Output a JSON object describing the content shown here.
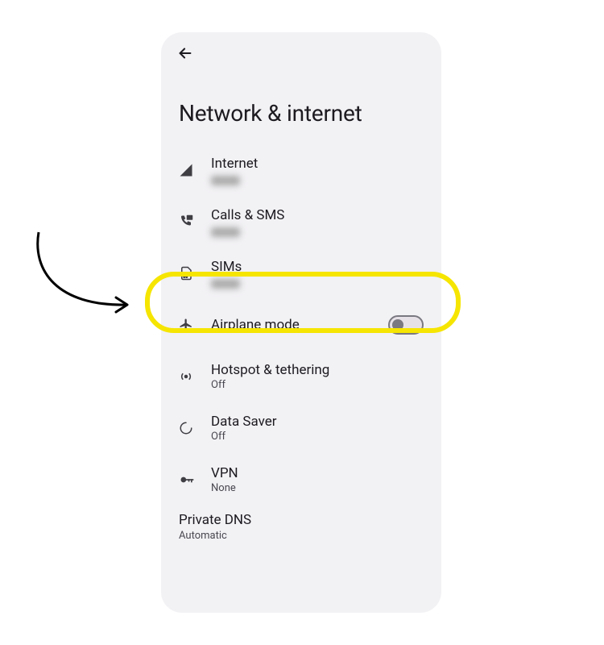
{
  "header": {
    "back_icon": "←",
    "title": "Network & internet"
  },
  "items": {
    "internet": {
      "label": "Internet",
      "subtitle": ""
    },
    "calls_sms": {
      "label": "Calls & SMS",
      "subtitle": ""
    },
    "sims": {
      "label": "SIMs",
      "subtitle": ""
    },
    "airplane": {
      "label": "Airplane mode"
    },
    "hotspot": {
      "label": "Hotspot & tethering",
      "subtitle": "Off"
    },
    "data_saver": {
      "label": "Data Saver",
      "subtitle": "Off"
    },
    "vpn": {
      "label": "VPN",
      "subtitle": "None"
    },
    "private_dns": {
      "label": "Private DNS",
      "subtitle": "Automatic"
    }
  },
  "annotation": {
    "highlight_target": "sims",
    "arrow": true
  }
}
